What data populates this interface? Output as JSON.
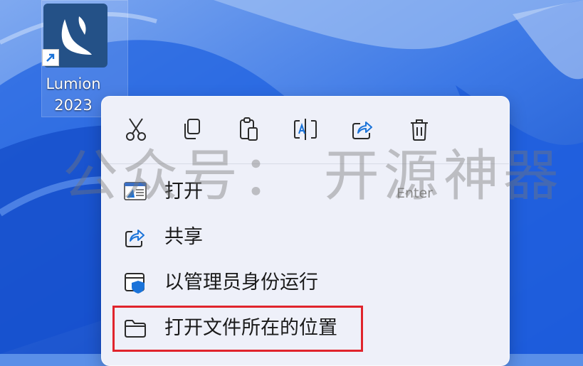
{
  "desktop": {
    "icon": {
      "label_line1": "Lumion",
      "label_line2": "2023"
    }
  },
  "context_menu": {
    "quick_actions": [
      {
        "name": "cut",
        "icon": "scissors-icon"
      },
      {
        "name": "copy",
        "icon": "copy-icon"
      },
      {
        "name": "paste",
        "icon": "clipboard-icon"
      },
      {
        "name": "rename",
        "icon": "rename-icon"
      },
      {
        "name": "share",
        "icon": "share-icon"
      },
      {
        "name": "delete",
        "icon": "trash-icon"
      }
    ],
    "items": [
      {
        "label": "打开",
        "shortcut": "Enter",
        "icon": "app-window-icon"
      },
      {
        "label": "共享",
        "icon": "share-icon"
      },
      {
        "label": "以管理员身份运行",
        "icon": "admin-shield-icon"
      },
      {
        "label": "打开文件所在的位置",
        "icon": "folder-icon"
      }
    ]
  },
  "watermark": "公众号： 开源神器",
  "colors": {
    "highlight": "#e0242c",
    "accent": "#1a73d9",
    "tile": "#245187"
  }
}
